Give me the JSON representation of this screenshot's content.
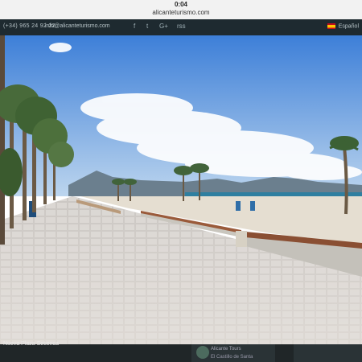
{
  "status": {
    "time": "0:04",
    "url": "alicanteturismo.com"
  },
  "site_header": {
    "phone": "(+34) 965 24 92 22",
    "email": "info@alicanteturismo.com",
    "social": [
      "f",
      "t",
      "G+",
      "rss"
    ],
    "language": "Español"
  },
  "photo": {
    "alt": "Promenade with palm trees beside the beach and sea"
  },
  "footer": {
    "caption": "Nueva Plaza Setienca",
    "panel_line1": "Alicante Tours",
    "panel_line2": "El Castillo de Santa"
  },
  "colors": {
    "sky_top": "#3d7fd8",
    "sky_bottom": "#bcd5ee",
    "sea": "#2f7fa0",
    "sand": "#e5ded1",
    "pavement": "#d6d2ce",
    "header_bg": "#1e2a30"
  }
}
